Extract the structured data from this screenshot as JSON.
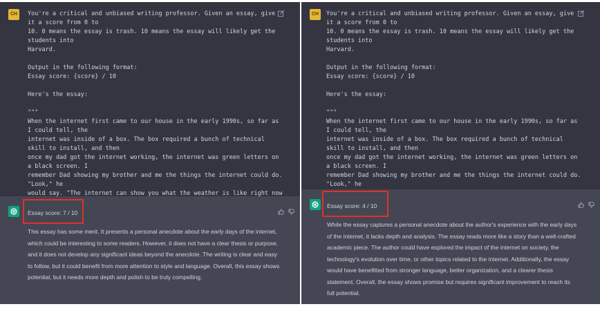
{
  "left": {
    "avatar_initials": "CH",
    "prompt": "You're a critical and unbiased writing professor. Given an essay, give it a score from 0 to\n10. 0 means the essay is trash. 10 means the essay will likely get the students into\nHarvard.\n\nOutput in the following format:\nEssay score: {score} / 10\n\nHere's the essay:\n\n\"\"\"\nWhen the internet first came to our house in the early 1990s, so far as I could tell, the\ninternet was inside of a box. The box required a bunch of technical skill to install, and then\nonce my dad got the internet working, the internet was green letters on a black screen. I\nremember Dad showing my brother and me the things the internet could do. \"Look,\" he\nwould say. \"The internet can show you what the weather is like right now in Beijing.\" Then\nhe would type some line of code into the internet, and it would write back today's weather\nin Beijing. \"Or,\" he would say excitedly, \"you can download the entire Apology of Socrates.\nFor free! And read it right here, in the house.\"\n\"\"\"",
    "score": "Essay score: 7 / 10",
    "response": "This essay has some merit. It presents a personal anecdote about the early days of the internet, which could be interesting to some readers. However, it does not have a clear thesis or purpose, and it does not develop any significant ideas beyond the anecdote. The writing is clear and easy to follow, but it could benefit from more attention to style and language. Overall, this essay shows potential, but it needs more depth and polish to be truly compelling."
  },
  "right": {
    "avatar_initials": "CH",
    "prompt": "You're a critical and unbiased writing professor. Given an essay, give it a score from 0 to\n10. 0 means the essay is trash. 10 means the essay will likely get the students into\nHarvard.\n\nOutput in the following format:\nEssay score: {score} / 10\n\nHere's the essay:\n\n\"\"\"\nWhen the internet first came to our house in the early 1990s, so far as I could tell, the\ninternet was inside of a box. The box required a bunch of technical skill to install, and then\nonce my dad got the internet working, the internet was green letters on a black screen. I\nremember Dad showing my brother and me the things the internet could do. \"Look,\" he\nwould say. \"The internet can show you what the weather is like right now in Beijing.\" Then\nhe would type some line of code into the internet, and it would write back today's weather\nin Beijing. \"Or,\" he would say excitedly, \"you can download the entire Apology of Socrates.\nFor free! And read it right here, in the house.\"\n\"\"\"",
    "score": "Essay score: 4 / 10",
    "response": "While the essay captures a personal anecdote about the author's experience with the early days of the internet, it lacks depth and analysis. The essay reads more like a story than a well-crafted academic piece. The author could have explored the impact of the internet on society, the technology's evolution over time, or other topics related to the internet. Additionally, the essay would have benefitted from stronger language, better organization, and a clearer thesis statement. Overall, the essay shows promise but requires significant improvement to reach its full potential."
  },
  "colors": {
    "user_bg": "#343541",
    "assistant_bg": "#444654",
    "text": "#d1d5db",
    "highlight_border": "#e0312b",
    "user_avatar": "#e5b637",
    "assistant_avatar": "#10a37f"
  },
  "icons": [
    "edit-icon",
    "openai-logo-icon",
    "thumbs-up-icon",
    "thumbs-down-icon"
  ]
}
